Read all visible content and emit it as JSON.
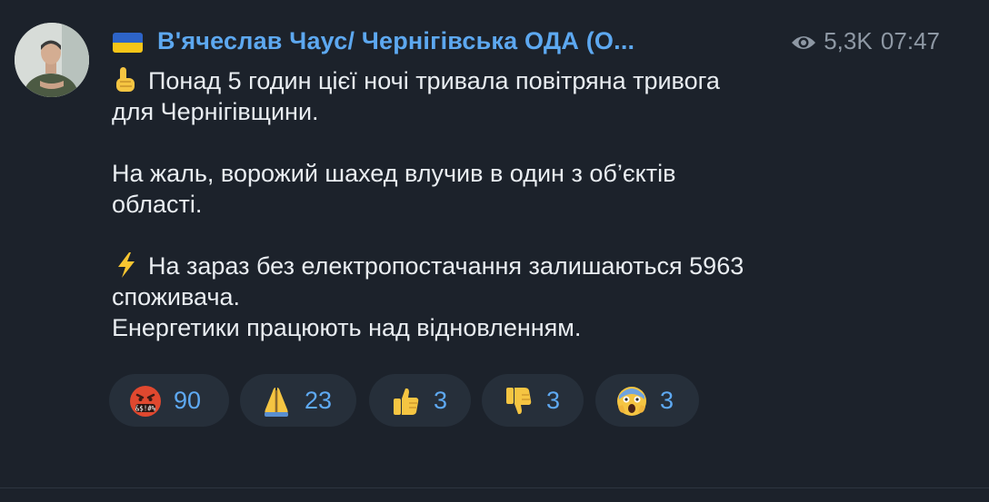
{
  "post": {
    "channel_name": "В'ячеслав Чаус/ Чернігівська ОДА (О...",
    "views": "5,3K",
    "time": "07:47",
    "paragraphs": [
      {
        "icon": "index-pointing-up-icon",
        "lines": [
          "Понад 5 годин цієї ночі тривала повітряна тривога",
          "для Чернігівщини."
        ]
      },
      {
        "icon": "",
        "lines": [
          "На жаль, ворожий шахед влучив в один з об’єктів",
          "області."
        ]
      },
      {
        "icon": "high-voltage-icon",
        "lines": [
          "На зараз без електропостачання залишаються 5963",
          "споживача.",
          "Енергетики працюють над відновленням."
        ]
      }
    ],
    "reactions": [
      {
        "icon": "angry-cursing-face-icon",
        "count": "90"
      },
      {
        "icon": "folded-hands-icon",
        "count": "23"
      },
      {
        "icon": "thumbs-up-icon",
        "count": "3"
      },
      {
        "icon": "thumbs-down-icon",
        "count": "3"
      },
      {
        "icon": "screaming-face-icon",
        "count": "3"
      }
    ]
  },
  "colors": {
    "background": "#1c222b",
    "channel_name": "#5da8f0",
    "meta": "#8e98a4",
    "text": "#e9edf1",
    "reaction_bg": "#262f3a",
    "reaction_count": "#5ea9f2"
  }
}
